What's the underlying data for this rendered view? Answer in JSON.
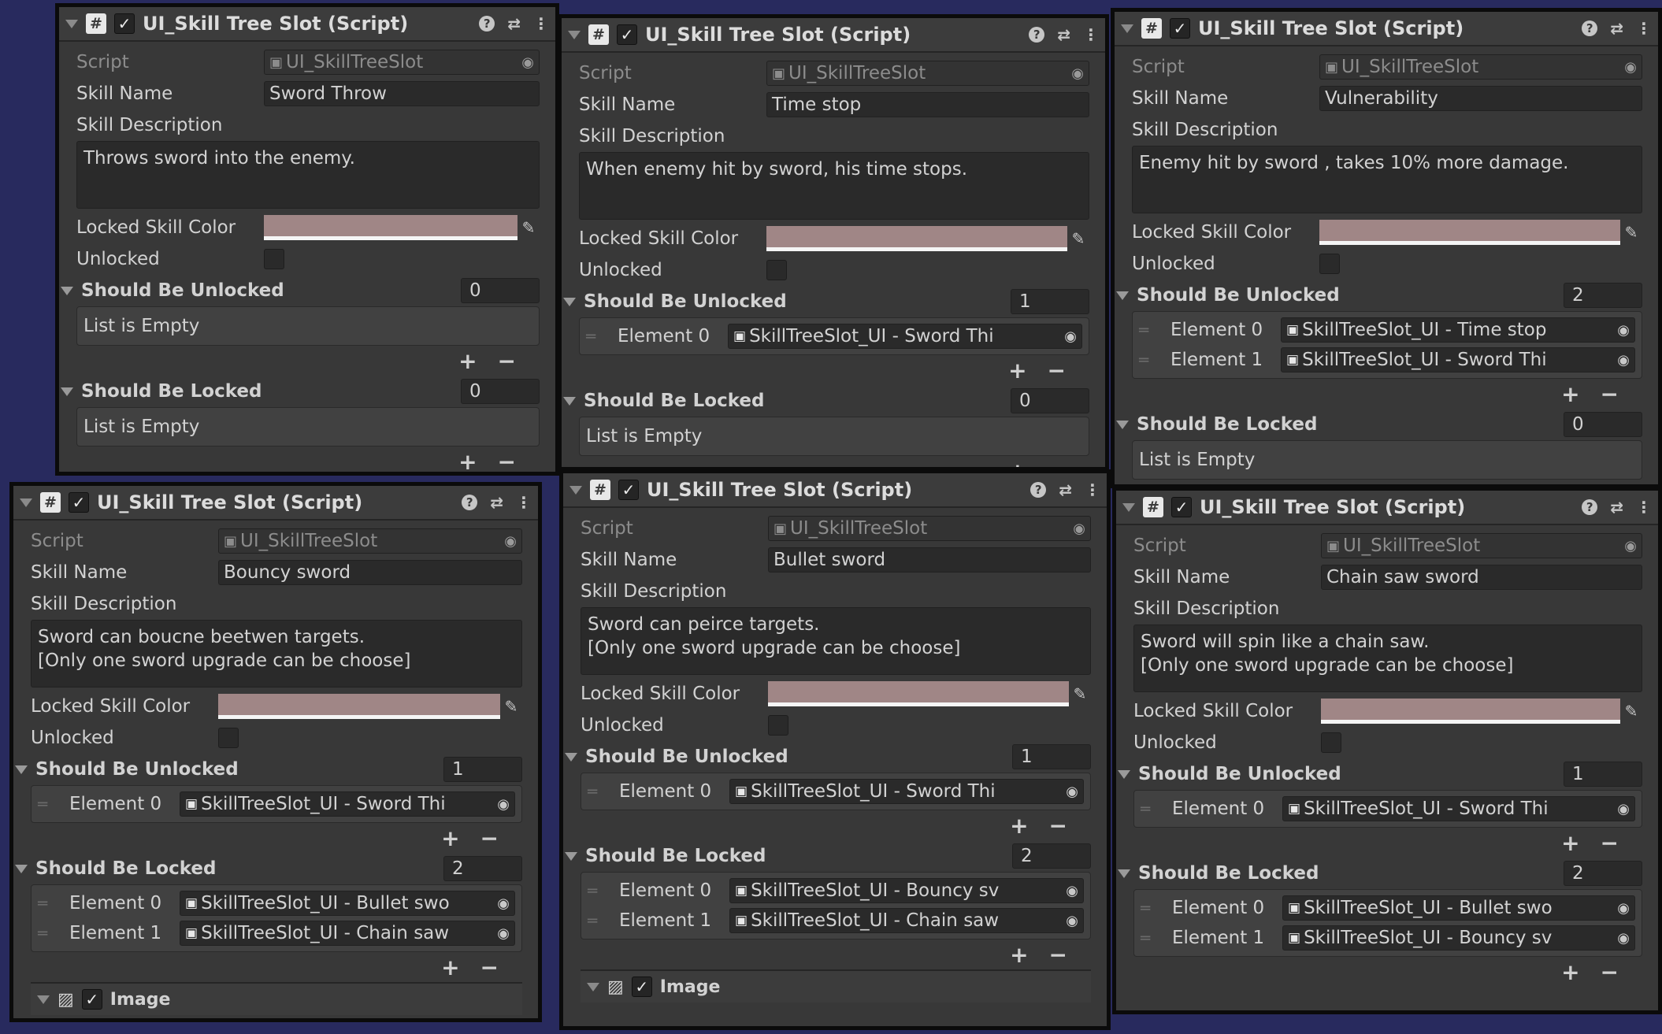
{
  "colors": {
    "background": "#282a5e",
    "panel": "#383838",
    "header": "#3c3c3c",
    "locked_color": "#a08686"
  },
  "panels": [
    {
      "header": {
        "title": "UI_Skill Tree Slot (Script)",
        "enabled": true
      },
      "labels": {
        "script": "Script",
        "skill_name": "Skill Name",
        "skill_description": "Skill Description",
        "locked_color": "Locked Skill Color",
        "unlocked": "Unlocked",
        "should_be_unlocked": "Should Be Unlocked",
        "should_be_locked": "Should Be Locked"
      },
      "script_value": "UI_SkillTreeSlot",
      "skill_name": "Sword Throw",
      "skill_description": "Throws sword into the enemy.",
      "unlocked": false,
      "should_be_unlocked": {
        "count": "0",
        "empty_text": "List is Empty",
        "elements": []
      },
      "should_be_locked": {
        "count": "0",
        "empty_text": "List is Empty",
        "elements": []
      },
      "footer": null
    },
    {
      "header": {
        "title": "UI_Skill Tree Slot (Script)",
        "enabled": true
      },
      "labels": {
        "script": "Script",
        "skill_name": "Skill Name",
        "skill_description": "Skill Description",
        "locked_color": "Locked Skill Color",
        "unlocked": "Unlocked",
        "should_be_unlocked": "Should Be Unlocked",
        "should_be_locked": "Should Be Locked"
      },
      "script_value": "UI_SkillTreeSlot",
      "skill_name": "Time stop",
      "skill_description": "When enemy hit by sword, his time stops.",
      "unlocked": false,
      "should_be_unlocked": {
        "count": "1",
        "empty_text": "",
        "elements": [
          {
            "label": "Element 0",
            "value": "SkillTreeSlot_UI - Sword Thi"
          }
        ]
      },
      "should_be_locked": {
        "count": "0",
        "empty_text": "List is Empty",
        "elements": []
      },
      "footer": null
    },
    {
      "header": {
        "title": "UI_Skill Tree Slot (Script)",
        "enabled": true
      },
      "labels": {
        "script": "Script",
        "skill_name": "Skill Name",
        "skill_description": "Skill Description",
        "locked_color": "Locked Skill Color",
        "unlocked": "Unlocked",
        "should_be_unlocked": "Should Be Unlocked",
        "should_be_locked": "Should Be Locked"
      },
      "script_value": "UI_SkillTreeSlot",
      "skill_name": "Vulnerability",
      "skill_description": "Enemy hit by sword , takes 10% more damage.",
      "unlocked": false,
      "should_be_unlocked": {
        "count": "2",
        "empty_text": "",
        "elements": [
          {
            "label": "Element 0",
            "value": "SkillTreeSlot_UI - Time stop"
          },
          {
            "label": "Element 1",
            "value": "SkillTreeSlot_UI - Sword Thi"
          }
        ]
      },
      "should_be_locked": {
        "count": "0",
        "empty_text": "List is Empty",
        "elements": []
      },
      "footer": null
    },
    {
      "header": {
        "title": "UI_Skill Tree Slot (Script)",
        "enabled": true
      },
      "labels": {
        "script": "Script",
        "skill_name": "Skill Name",
        "skill_description": "Skill Description",
        "locked_color": "Locked Skill Color",
        "unlocked": "Unlocked",
        "should_be_unlocked": "Should Be Unlocked",
        "should_be_locked": "Should Be Locked"
      },
      "script_value": "UI_SkillTreeSlot",
      "skill_name": "Bouncy sword",
      "skill_description": "Sword can boucne beetwen targets.\n[Only one sword upgrade can be choose]",
      "unlocked": false,
      "should_be_unlocked": {
        "count": "1",
        "empty_text": "",
        "elements": [
          {
            "label": "Element 0",
            "value": "SkillTreeSlot_UI - Sword Thi"
          }
        ]
      },
      "should_be_locked": {
        "count": "2",
        "empty_text": "",
        "elements": [
          {
            "label": "Element 0",
            "value": "SkillTreeSlot_UI - Bullet swo"
          },
          {
            "label": "Element 1",
            "value": "SkillTreeSlot_UI - Chain saw"
          }
        ]
      },
      "footer": {
        "title": "Image"
      }
    },
    {
      "header": {
        "title": "UI_Skill Tree Slot (Script)",
        "enabled": true
      },
      "labels": {
        "script": "Script",
        "skill_name": "Skill Name",
        "skill_description": "Skill Description",
        "locked_color": "Locked Skill Color",
        "unlocked": "Unlocked",
        "should_be_unlocked": "Should Be Unlocked",
        "should_be_locked": "Should Be Locked"
      },
      "script_value": "UI_SkillTreeSlot",
      "skill_name": "Bullet sword",
      "skill_description": "Sword can peirce targets.\n[Only one sword upgrade can be choose]",
      "unlocked": false,
      "should_be_unlocked": {
        "count": "1",
        "empty_text": "",
        "elements": [
          {
            "label": "Element 0",
            "value": "SkillTreeSlot_UI - Sword Thi"
          }
        ]
      },
      "should_be_locked": {
        "count": "2",
        "empty_text": "",
        "elements": [
          {
            "label": "Element 0",
            "value": "SkillTreeSlot_UI - Bouncy sv"
          },
          {
            "label": "Element 1",
            "value": "SkillTreeSlot_UI - Chain saw"
          }
        ]
      },
      "footer": {
        "title": "Image"
      }
    },
    {
      "header": {
        "title": "UI_Skill Tree Slot (Script)",
        "enabled": true
      },
      "labels": {
        "script": "Script",
        "skill_name": "Skill Name",
        "skill_description": "Skill Description",
        "locked_color": "Locked Skill Color",
        "unlocked": "Unlocked",
        "should_be_unlocked": "Should Be Unlocked",
        "should_be_locked": "Should Be Locked"
      },
      "script_value": "UI_SkillTreeSlot",
      "skill_name": "Chain saw sword",
      "skill_description": "Sword will spin like a chain saw.\n[Only one sword upgrade can be choose]",
      "unlocked": false,
      "should_be_unlocked": {
        "count": "1",
        "empty_text": "",
        "elements": [
          {
            "label": "Element 0",
            "value": "SkillTreeSlot_UI - Sword Thi"
          }
        ]
      },
      "should_be_locked": {
        "count": "2",
        "empty_text": "",
        "elements": [
          {
            "label": "Element 0",
            "value": "SkillTreeSlot_UI - Bullet swo"
          },
          {
            "label": "Element 1",
            "value": "SkillTreeSlot_UI - Bouncy sv"
          }
        ]
      },
      "footer": null
    }
  ]
}
